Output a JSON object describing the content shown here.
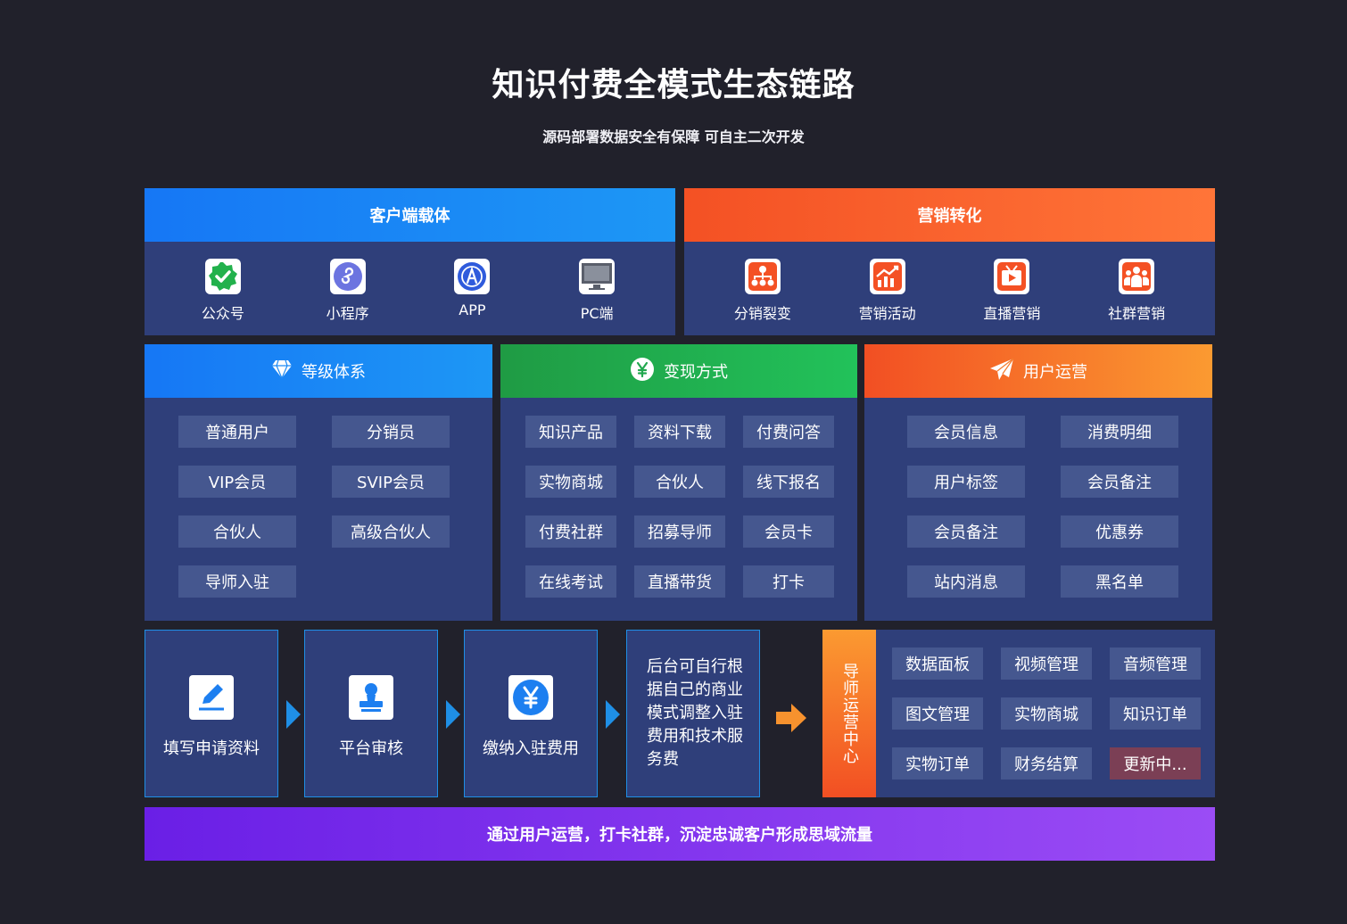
{
  "title": "知识付费全模式生态链路",
  "subtitle": "源码部署数据安全有保障  可自主二次开发",
  "client": {
    "header": "客户端载体",
    "items": [
      {
        "label": "公众号",
        "icon": "wechat-verified-icon"
      },
      {
        "label": "小程序",
        "icon": "mini-program-icon"
      },
      {
        "label": "APP",
        "icon": "app-store-icon"
      },
      {
        "label": "PC端",
        "icon": "monitor-icon"
      }
    ]
  },
  "marketing": {
    "header": "营销转化",
    "items": [
      {
        "label": "分销裂变",
        "icon": "org-tree-icon"
      },
      {
        "label": "营销活动",
        "icon": "growth-chart-icon"
      },
      {
        "label": "直播营销",
        "icon": "live-tv-icon"
      },
      {
        "label": "社群营销",
        "icon": "group-icon"
      }
    ]
  },
  "levels": {
    "header": "等级体系",
    "chips": [
      "普通用户",
      "分销员",
      "VIP会员",
      "SVIP会员",
      "合伙人",
      "高级合伙人",
      "导师入驻"
    ]
  },
  "monetize": {
    "header": "变现方式",
    "chips": [
      "知识产品",
      "资料下载",
      "付费问答",
      "实物商城",
      "合伙人",
      "线下报名",
      "付费社群",
      "招募导师",
      "会员卡",
      "在线考试",
      "直播带货",
      "打卡"
    ]
  },
  "userops": {
    "header": "用户运营",
    "chips": [
      "会员信息",
      "消费明细",
      "用户标签",
      "会员备注",
      "会员备注",
      "优惠券",
      "站内消息",
      "黑名单"
    ]
  },
  "steps": [
    {
      "label": "填写申请资料",
      "icon": "edit-icon"
    },
    {
      "label": "平台审核",
      "icon": "approve-stamp-icon"
    },
    {
      "label": "缴纳入驻费用",
      "icon": "yen-coin-icon"
    }
  ],
  "note": "后台可自行根据自己的商业模式调整入驻费用和技术服务费",
  "mentor_center": {
    "label": "导师运营中心",
    "chips": [
      "数据面板",
      "视频管理",
      "音频管理",
      "图文管理",
      "实物商城",
      "知识订单",
      "实物订单",
      "财务结算",
      "更新中..."
    ]
  },
  "bottom": "通过用户运营，打卡社群，沉淀忠诚客户形成思域流量",
  "colors": {
    "background": "#21212b",
    "panel": "#2f3f7a",
    "chip": "#45578f",
    "blue": "#1677f5",
    "orange": "#f45124",
    "green": "#22c25a",
    "purple": "#6a1fe6"
  }
}
